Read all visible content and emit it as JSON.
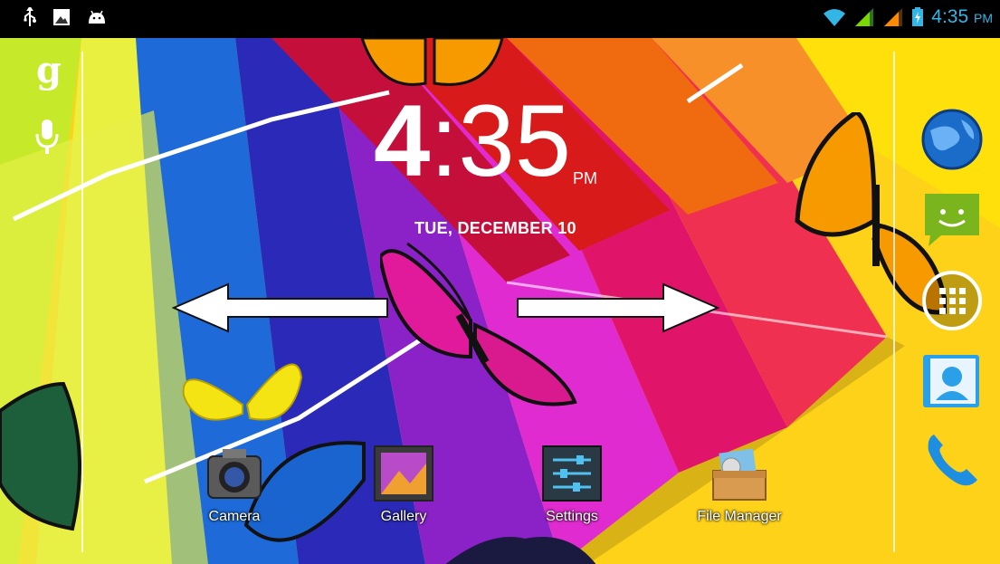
{
  "status_bar": {
    "time": "4:35",
    "ampm": "PM",
    "left_icons": [
      "usb-icon",
      "screenshot-icon",
      "android-debug-icon"
    ],
    "right_icons": [
      "wifi-icon",
      "signal-icon",
      "signal-icon",
      "battery-charging-icon"
    ],
    "accent_color": "#33b5e5"
  },
  "clock_widget": {
    "hour": "4",
    "colon_minutes": ":35",
    "ampm": "PM",
    "date": "TUE, DECEMBER 10"
  },
  "search_bar": {
    "google_glyph": "g",
    "icons": [
      "google-search-icon",
      "microphone-icon"
    ]
  },
  "dock": {
    "icons": [
      "browser-globe-icon",
      "messaging-icon",
      "all-apps-icon",
      "contacts-icon",
      "phone-icon"
    ]
  },
  "apps": [
    {
      "label": "Camera",
      "icon": "camera-icon"
    },
    {
      "label": "Gallery",
      "icon": "gallery-icon"
    },
    {
      "label": "Settings",
      "icon": "settings-icon"
    },
    {
      "label": "File Manager",
      "icon": "file-manager-icon"
    }
  ],
  "overlay": {
    "arrows": [
      "swipe-left-arrow-icon",
      "swipe-right-arrow-icon"
    ]
  }
}
